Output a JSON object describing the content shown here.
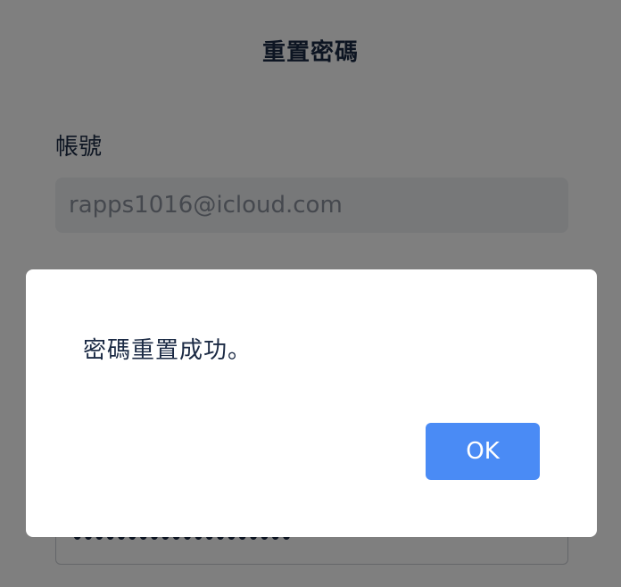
{
  "page": {
    "title": "重置密碼",
    "account_label": "帳號",
    "account_value": "rapps1016@icloud.com",
    "password_mask": "••••••••••••••••••••"
  },
  "dialog": {
    "message": "密碼重置成功。",
    "ok_label": "OK"
  },
  "colors": {
    "accent": "#4a8bf5",
    "text": "#1b2a44",
    "overlay": "rgba(0,0,0,0.5)"
  }
}
